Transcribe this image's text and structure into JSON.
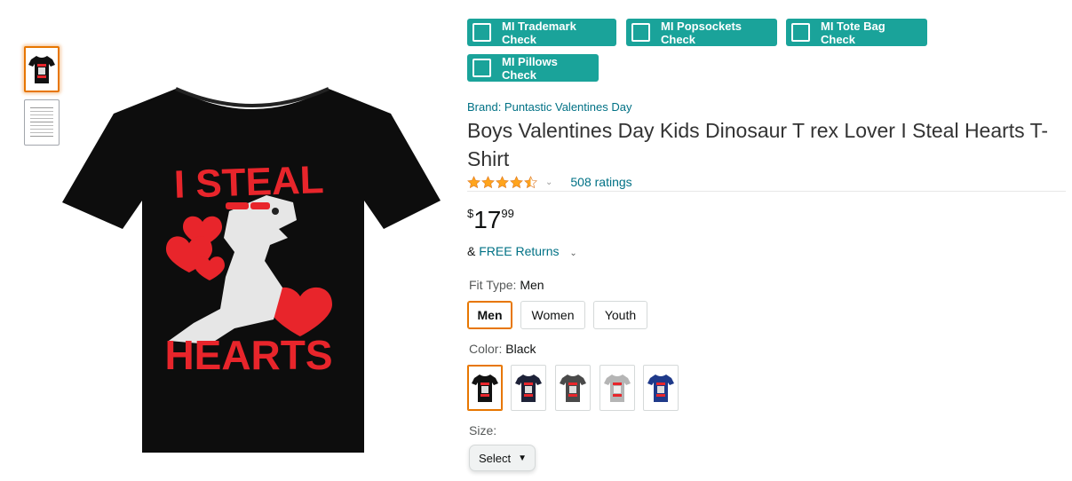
{
  "check_buttons": [
    {
      "label": "MI Trademark Check"
    },
    {
      "label": "MI Popsockets Check"
    },
    {
      "label": "MI Tote Bag Check"
    },
    {
      "label": "MI Pillows Check"
    }
  ],
  "product": {
    "brand": "Brand: Puntastic Valentines Day",
    "title": "Boys Valentines Day Kids Dinosaur T rex Lover I Steal Hearts T-Shirt",
    "rating": 4.5,
    "ratings_count": "508 ratings",
    "price": {
      "symbol": "$",
      "whole": "17",
      "fraction": "99"
    },
    "returns_prefix": "&",
    "returns_link": "FREE Returns",
    "graphic_text_top": "I STEAL",
    "graphic_text_bottom": "HEARTS"
  },
  "fit_type": {
    "label": "Fit Type:",
    "selected": "Men",
    "options": [
      "Men",
      "Women",
      "Youth"
    ]
  },
  "color": {
    "label": "Color:",
    "selected": "Black",
    "swatches": [
      {
        "name": "Black",
        "hex": "#111111"
      },
      {
        "name": "Navy",
        "hex": "#1e2238"
      },
      {
        "name": "Dark Heather",
        "hex": "#4a4a4a"
      },
      {
        "name": "Heather Grey",
        "hex": "#b5b5b5"
      },
      {
        "name": "Royal Blue",
        "hex": "#1f3a8a"
      }
    ]
  },
  "size": {
    "label": "Size:",
    "select_label": "Select"
  },
  "colors": {
    "teal": "#1aa39a",
    "link": "#007185",
    "star": "#ffa41c",
    "graphic_red": "#e8252b"
  }
}
